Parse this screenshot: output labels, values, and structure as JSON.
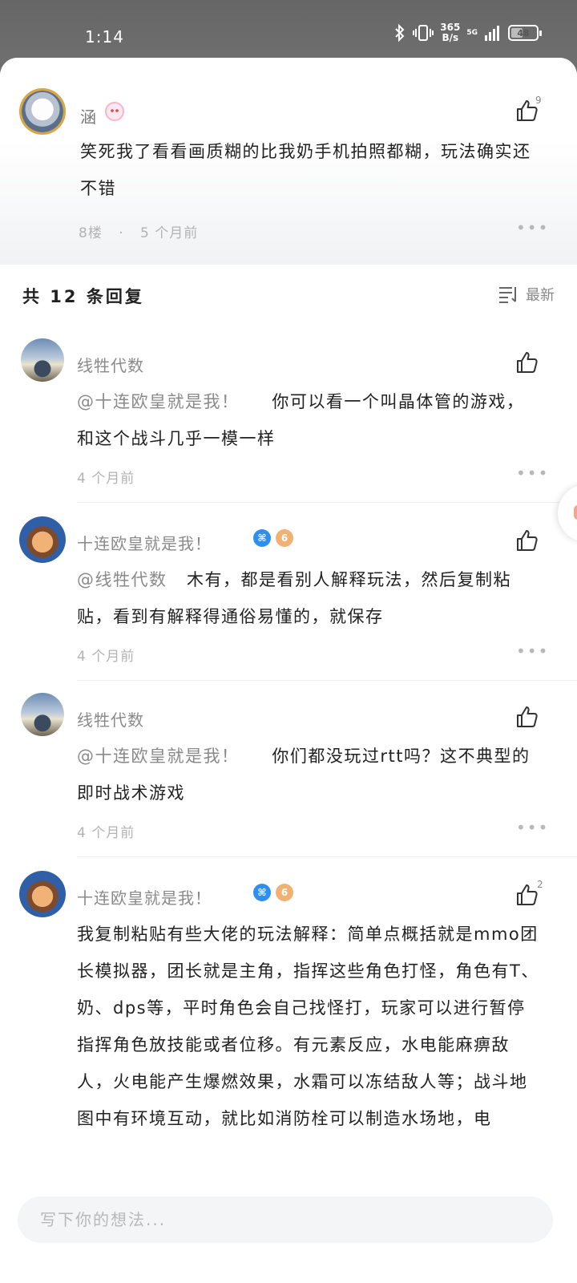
{
  "status_bar": {
    "time": "1:14",
    "net_speed_top": "365",
    "net_speed_bottom": "B/s",
    "network": "5G",
    "battery": "48"
  },
  "main_comment": {
    "username": "涵",
    "text": "笑死我了看看画质糊的比我奶手机拍照都糊，玩法确实还不错",
    "floor": "8楼",
    "separator": "·",
    "time": "5 个月前",
    "like_count": "9",
    "more": "•••"
  },
  "replies_header": {
    "title": "共 12 条回复",
    "sort_label": "最新"
  },
  "replies": [
    {
      "username": "线牲代数",
      "mention": "@十连欧皇就是我！",
      "text": "你可以看一个叫晶体管的游戏，和这个战斗几乎一模一样",
      "time": "4 个月前",
      "more": "•••"
    },
    {
      "username": "十连欧皇就是我！",
      "mention": "@线牲代数",
      "text": "木有，都是看别人解释玩法，然后复制粘贴，看到有解释得通俗易懂的，就保存",
      "time": "4 个月前",
      "more": "•••",
      "badge_level": "6"
    },
    {
      "username": "线牲代数",
      "mention": "@十连欧皇就是我！",
      "text": "你们都没玩过rtt吗？这不典型的即时战术游戏",
      "time": "4 个月前",
      "more": "•••"
    },
    {
      "username": "十连欧皇就是我！",
      "text": "我复制粘贴有些大佬的玩法解释：简单点概括就是mmo团长模拟器，团长就是主角，指挥这些角色打怪，角色有T、奶、dps等，平时角色会自己找怪打，玩家可以进行暂停指挥角色放技能或者位移。有元素反应，水电能麻痹敌人，火电能产生爆燃效果，水霜可以冻结敌人等；战斗地图中有环境互动，就比如消防栓可以制造水场地，电",
      "like_count": "2",
      "badge_level": "6"
    }
  ],
  "composer": {
    "placeholder": "写下你的想法..."
  }
}
